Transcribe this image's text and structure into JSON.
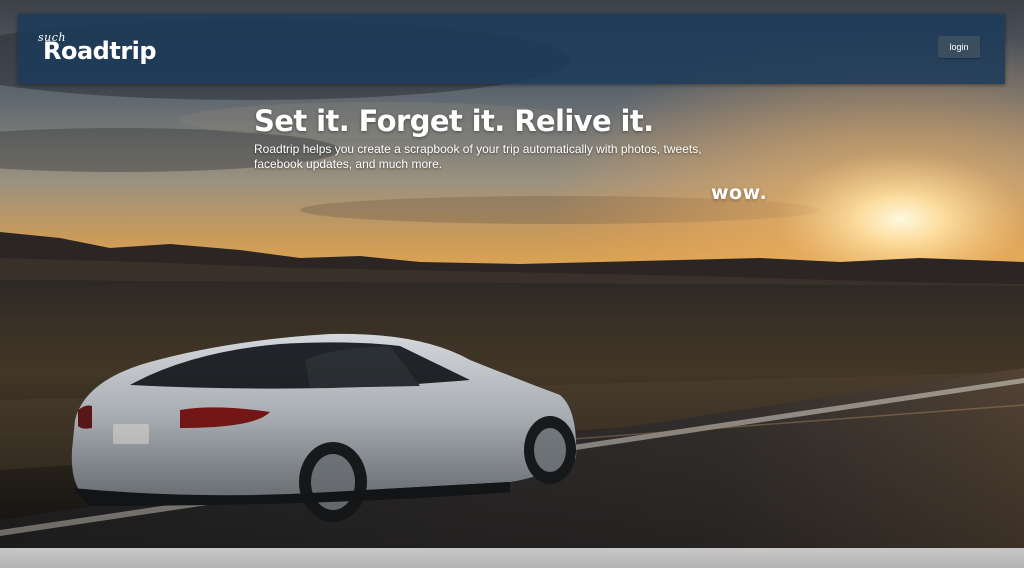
{
  "navbar": {
    "brand_small": "such",
    "brand_main": "Roadtrip",
    "login_label": "login"
  },
  "hero": {
    "headline": "Set it. Forget it. Relive it.",
    "tagline": "Roadtrip helps you create a scrapbook of your trip automatically with photos, tweets, facebook updates, and much more.",
    "aside": "wow.",
    "background_image": "white car driving on desert highway at sunset"
  },
  "colors": {
    "navbar_bg": "#1c3a5a",
    "login_bg": "#3b4e5d",
    "text": "#ffffff"
  }
}
